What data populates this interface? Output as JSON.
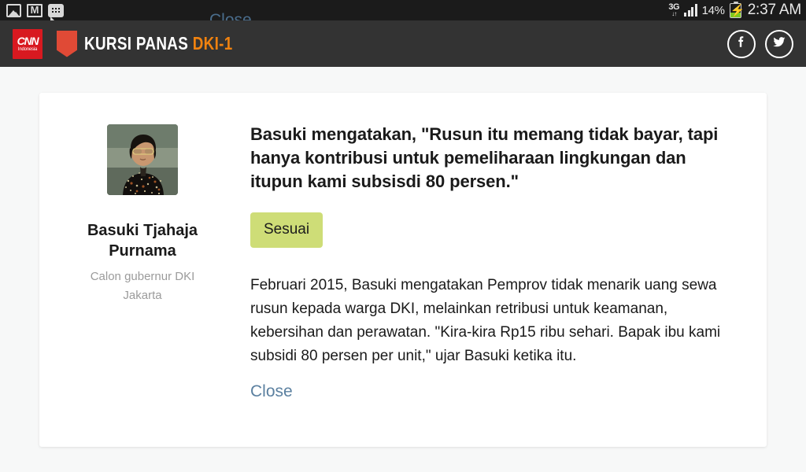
{
  "statusbar": {
    "left_icons": [
      "photo-icon",
      "gmail-icon",
      "bbm-icon"
    ],
    "network_type": "3G",
    "network_arrows": "↓↑",
    "signal_bars": 4,
    "battery_percent": "14%",
    "battery_charging": true,
    "time": "2:37 AM"
  },
  "header": {
    "logo_word": "CNN",
    "logo_sub": "Indonesia",
    "brand_title": "KURSI PANAS",
    "brand_accent": "DKI-1",
    "social": [
      {
        "name": "facebook",
        "label": "f"
      },
      {
        "name": "twitter",
        "label": "t"
      }
    ]
  },
  "ghost_close_label": "Close",
  "card": {
    "person": {
      "name": "Basuki Tjahaja Purnama",
      "role": "Calon gubernur DKI Jakarta",
      "avatar_alt": "Basuki Tjahaja Purnama portrait"
    },
    "quote": "Basuki mengatakan, \"Rusun itu memang tidak bayar, tapi hanya kontribusi untuk pemeliharaan lingkungan dan itupun kami subsisdi 80 persen.\"",
    "verdict": "Sesuai",
    "verdict_color": "#cedd77",
    "body": "Februari 2015, Basuki mengatakan Pemprov tidak menarik uang sewa rusun kepada warga DKI, melainkan retribusi untuk keamanan, kebersihan dan perawatan. \"Kira-kira Rp15 ribu sehari. Bapak ibu kami subsidi 80 persen per unit,\" ujar Basuki ketika itu.",
    "close_label": "Close"
  },
  "colors": {
    "page_bg": "#f7f8f8",
    "statusbar_bg": "#1b1b1b",
    "header_bg": "#333333",
    "brand_red": "#d81920",
    "brand_orange": "#f0820f",
    "link_blue": "#5b80a0"
  }
}
